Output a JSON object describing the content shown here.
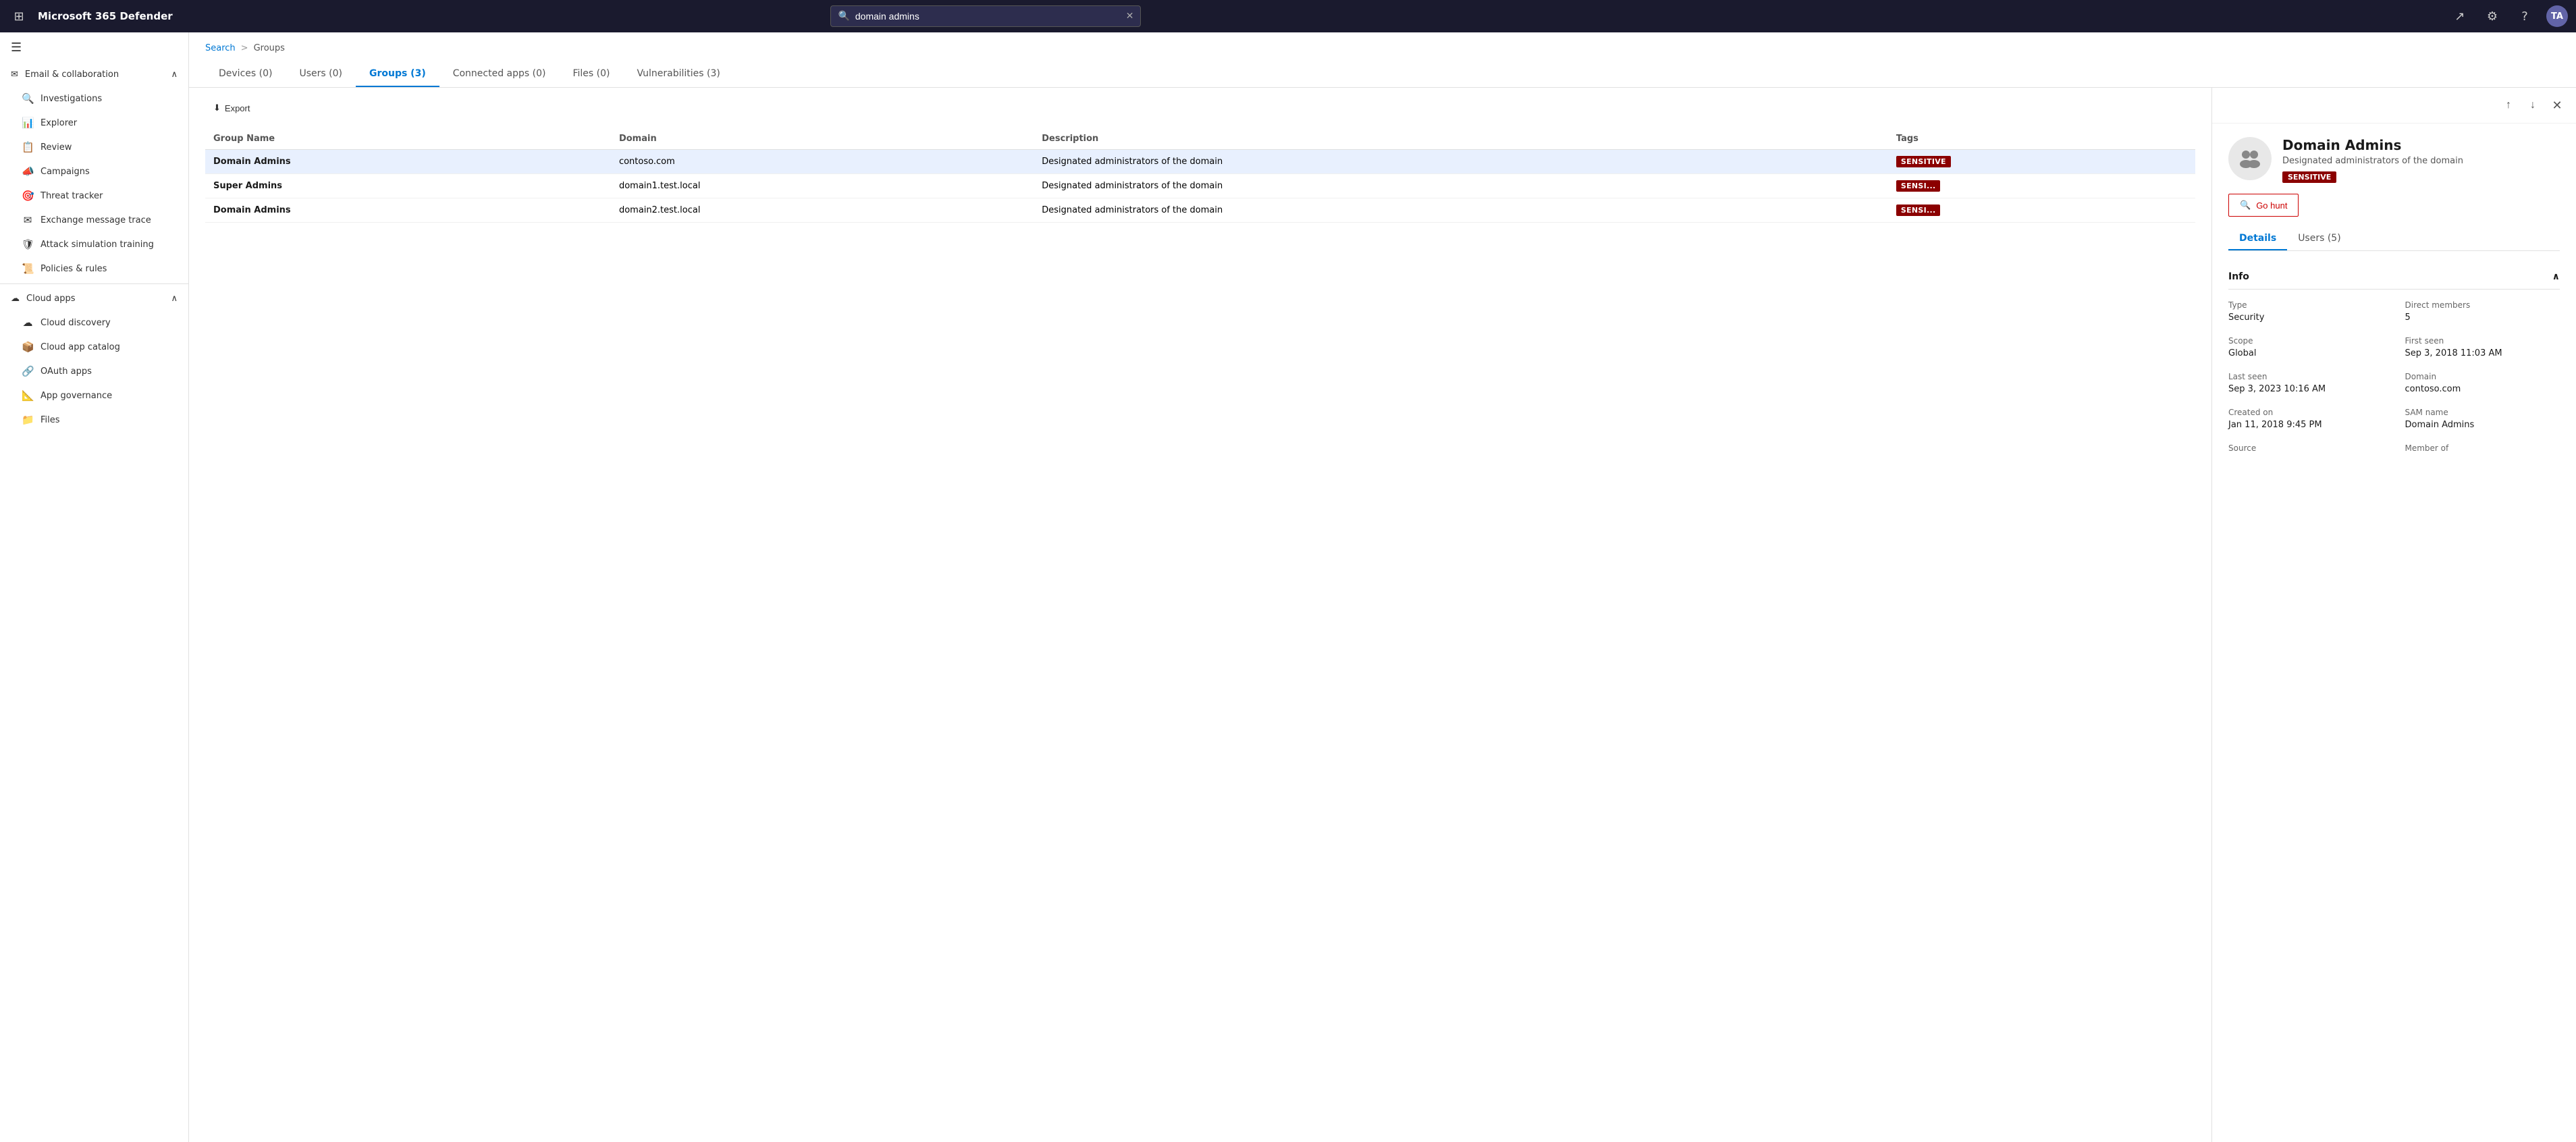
{
  "app": {
    "title": "Microsoft 365 Defender"
  },
  "topbar": {
    "search_placeholder": "domain admins",
    "search_value": "domain admins",
    "clear_icon": "✕",
    "apps_icon": "⊞",
    "settings_icon": "⚙",
    "help_icon": "?",
    "avatar_initials": "TA"
  },
  "sidebar": {
    "toggle_icon": "☰",
    "email_collab": {
      "label": "Email & collaboration",
      "expanded": true
    },
    "items_email": [
      {
        "id": "investigations",
        "label": "Investigations",
        "icon": "🔍"
      },
      {
        "id": "explorer",
        "label": "Explorer",
        "icon": "📊"
      },
      {
        "id": "review",
        "label": "Review",
        "icon": "📋"
      },
      {
        "id": "campaigns",
        "label": "Campaigns",
        "icon": "📣"
      },
      {
        "id": "threat-tracker",
        "label": "Threat tracker",
        "icon": "🎯"
      },
      {
        "id": "exchange-message-trace",
        "label": "Exchange message trace",
        "icon": "✉"
      },
      {
        "id": "attack-simulation",
        "label": "Attack simulation training",
        "icon": "🛡"
      },
      {
        "id": "policies-rules",
        "label": "Policies & rules",
        "icon": "📜"
      }
    ],
    "cloud_apps": {
      "label": "Cloud apps",
      "expanded": true
    },
    "items_cloud": [
      {
        "id": "cloud-discovery",
        "label": "Cloud discovery",
        "icon": "☁"
      },
      {
        "id": "cloud-app-catalog",
        "label": "Cloud app catalog",
        "icon": "📦"
      },
      {
        "id": "oauth-apps",
        "label": "OAuth apps",
        "icon": "🔗"
      },
      {
        "id": "app-governance",
        "label": "App governance",
        "icon": "📐"
      },
      {
        "id": "files",
        "label": "Files",
        "icon": "📁"
      }
    ]
  },
  "breadcrumb": {
    "search": "Search",
    "separator": ">",
    "groups": "Groups"
  },
  "tabs": [
    {
      "id": "devices",
      "label": "Devices (0)"
    },
    {
      "id": "users",
      "label": "Users (0)"
    },
    {
      "id": "groups",
      "label": "Groups (3)",
      "active": true
    },
    {
      "id": "connected-apps",
      "label": "Connected apps (0)"
    },
    {
      "id": "files",
      "label": "Files (0)"
    },
    {
      "id": "vulnerabilities",
      "label": "Vulnerabilities (3)"
    }
  ],
  "toolbar": {
    "export_label": "Export",
    "export_icon": "⬇"
  },
  "table": {
    "columns": [
      "Group Name",
      "Domain",
      "Description",
      "Tags"
    ],
    "rows": [
      {
        "name": "Domain Admins",
        "domain": "contoso.com",
        "description": "Designated administrators of the domain",
        "tag": "SENSITIVE",
        "selected": true
      },
      {
        "name": "Super Admins",
        "domain": "domain1.test.local",
        "description": "Designated administrators of the domain",
        "tag": "SENSI...",
        "selected": false
      },
      {
        "name": "Domain Admins",
        "domain": "domain2.test.local",
        "description": "Designated administrators of the domain",
        "tag": "SENSI...",
        "selected": false
      }
    ]
  },
  "detail_panel": {
    "nav_up_icon": "↑",
    "nav_down_icon": "↓",
    "close_icon": "✕",
    "avatar_icon": "👥",
    "title": "Domain Admins",
    "subtitle": "Designated administrators of the domain",
    "badge": "SENSITIVE",
    "go_hunt_label": "Go hunt",
    "go_hunt_icon": "🔍",
    "tabs": [
      {
        "id": "details",
        "label": "Details",
        "active": true
      },
      {
        "id": "users",
        "label": "Users (5)"
      }
    ],
    "info_section": {
      "label": "Info",
      "expanded": true,
      "collapse_icon": "∧",
      "fields": {
        "type_label": "Type",
        "type_value": "Security",
        "direct_members_label": "Direct members",
        "direct_members_value": "5",
        "scope_label": "Scope",
        "scope_value": "Global",
        "first_seen_label": "First seen",
        "first_seen_value": "Sep 3, 2018 11:03 AM",
        "last_seen_label": "Last seen",
        "last_seen_value": "Sep 3, 2023 10:16 AM",
        "domain_label": "Domain",
        "domain_value": "contoso.com",
        "created_on_label": "Created on",
        "created_on_value": "Jan 11, 2018 9:45 PM",
        "sam_name_label": "SAM name",
        "sam_name_value": "Domain Admins",
        "source_label": "Source",
        "member_of_label": "Member of"
      }
    }
  }
}
